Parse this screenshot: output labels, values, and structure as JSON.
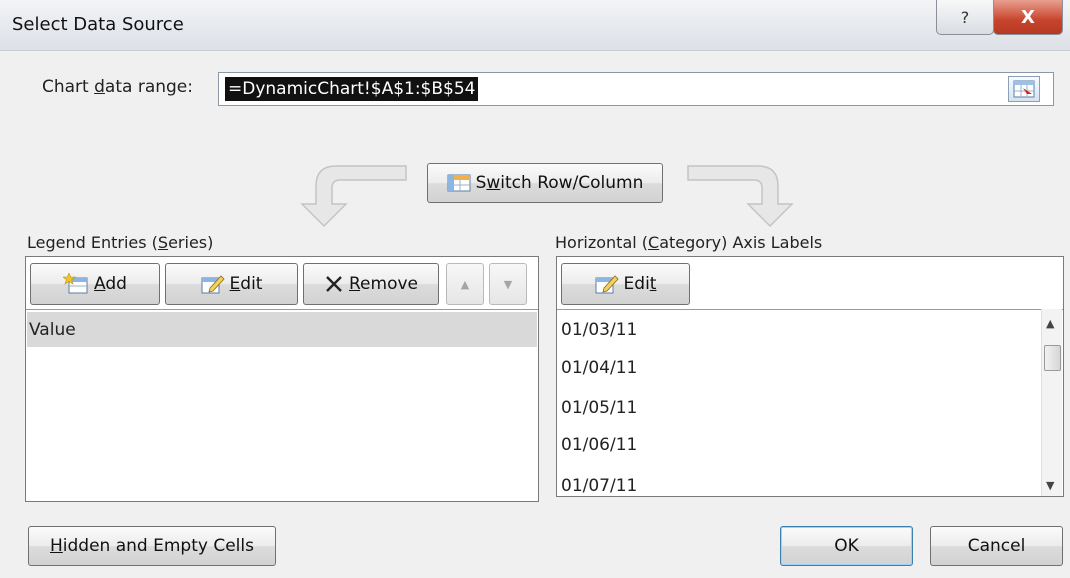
{
  "dialog": {
    "title": "Select Data Source",
    "help_label": "?",
    "close_label": "X"
  },
  "range": {
    "label_pre": "Chart ",
    "label_mnemonic": "d",
    "label_post": "ata range:",
    "value": "=DynamicChart!$A$1:$B$54"
  },
  "switch_button": {
    "pre": "S",
    "mnemonic": "w",
    "post": "itch Row/Column"
  },
  "legend": {
    "heading_pre": "Legend Entries (",
    "heading_mnemonic": "S",
    "heading_post": "eries)",
    "add": {
      "mnemonic": "A",
      "rest": "dd"
    },
    "edit": {
      "mnemonic": "E",
      "rest": "dit"
    },
    "remove": {
      "mnemonic": "R",
      "rest": "emove"
    },
    "move_up": "▲",
    "move_down": "▼",
    "items": [
      "Value"
    ]
  },
  "axis": {
    "heading_pre": "Horizontal (",
    "heading_mnemonic": "C",
    "heading_post": "ategory) Axis Labels",
    "edit": {
      "pre": "Edi",
      "mnemonic": "t"
    },
    "items": [
      "01/03/11",
      "01/04/11",
      "01/05/11",
      "01/06/11",
      "01/07/11"
    ]
  },
  "footer": {
    "hidden_mnemonic": "H",
    "hidden_rest": "idden and Empty Cells",
    "ok": "OK",
    "cancel": "Cancel"
  },
  "icons": {
    "scroll_up": "▲",
    "scroll_down": "▼"
  }
}
